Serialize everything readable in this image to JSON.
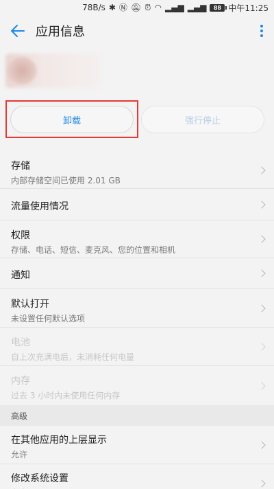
{
  "status_bar": {
    "speed": "78B/s",
    "battery": "88",
    "time": "中午11:25"
  },
  "title_bar": {
    "title": "应用信息"
  },
  "buttons": {
    "uninstall": "卸载",
    "force_stop": "强行停止"
  },
  "items": [
    {
      "title": "存储",
      "subtitle": "内部存储空间已使用 2.01 GB",
      "enabled": true
    },
    {
      "title": "流量使用情况",
      "subtitle": "",
      "enabled": true
    },
    {
      "title": "权限",
      "subtitle": "存储、电话、短信、麦克风、您的位置和相机",
      "enabled": true
    },
    {
      "title": "通知",
      "subtitle": "",
      "enabled": true
    },
    {
      "title": "默认打开",
      "subtitle": "未设置任何默认选项",
      "enabled": true
    },
    {
      "title": "电池",
      "subtitle": "自上次充满电后，未消耗任何电量",
      "enabled": false
    },
    {
      "title": "内存",
      "subtitle": "过去 3 小时内未使用任何内存",
      "enabled": false
    }
  ],
  "section_advanced": "高级",
  "advanced_items": [
    {
      "title": "在其他应用的上层显示",
      "subtitle": "允许"
    },
    {
      "title": "修改系统设置",
      "subtitle": "允许"
    }
  ],
  "colors": {
    "accent": "#1e88e5",
    "highlight": "#e53935"
  }
}
